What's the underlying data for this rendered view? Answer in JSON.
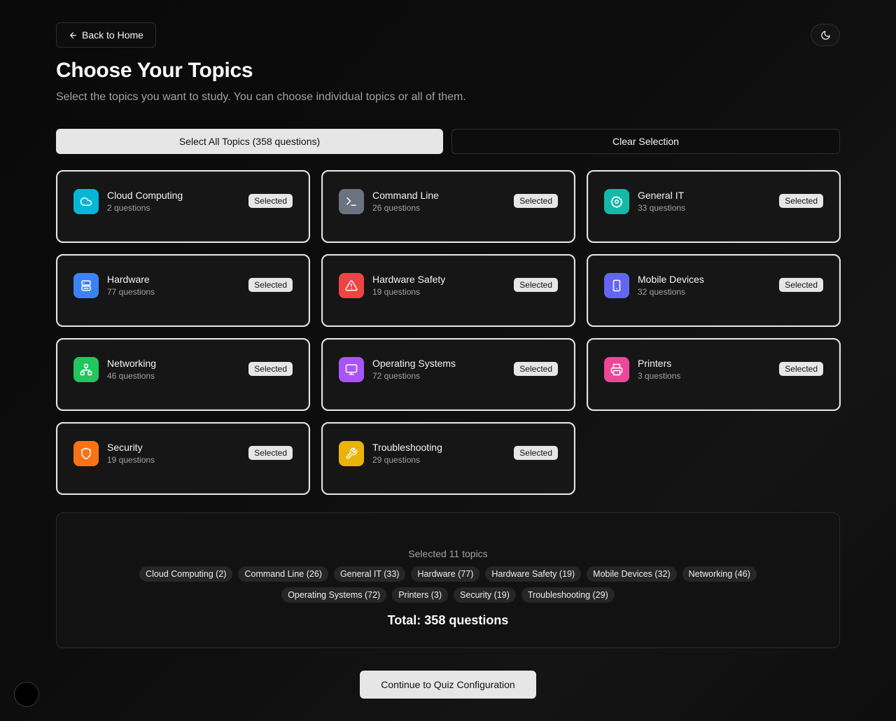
{
  "header": {
    "back_label": "Back to Home",
    "title": "Choose Your Topics",
    "subtitle": "Select the topics you want to study. You can choose individual topics or all of them."
  },
  "actions": {
    "select_all_label": "Select All Topics (358 questions)",
    "clear_label": "Clear Selection"
  },
  "topics": [
    {
      "name": "Cloud Computing",
      "count": "2 questions",
      "badge": "Selected",
      "icon": "cloud-icon",
      "color": "#06b6d4"
    },
    {
      "name": "Command Line",
      "count": "26 questions",
      "badge": "Selected",
      "icon": "terminal-icon",
      "color": "#6b7280"
    },
    {
      "name": "General IT",
      "count": "33 questions",
      "badge": "Selected",
      "icon": "gear-icon",
      "color": "#14b8a6"
    },
    {
      "name": "Hardware",
      "count": "77 questions",
      "badge": "Selected",
      "icon": "server-icon",
      "color": "#3b82f6"
    },
    {
      "name": "Hardware Safety",
      "count": "19 questions",
      "badge": "Selected",
      "icon": "warning-icon",
      "color": "#ef4444"
    },
    {
      "name": "Mobile Devices",
      "count": "32 questions",
      "badge": "Selected",
      "icon": "tablet-icon",
      "color": "#6366f1"
    },
    {
      "name": "Networking",
      "count": "46 questions",
      "badge": "Selected",
      "icon": "network-icon",
      "color": "#22c55e"
    },
    {
      "name": "Operating Systems",
      "count": "72 questions",
      "badge": "Selected",
      "icon": "monitor-icon",
      "color": "#a855f7"
    },
    {
      "name": "Printers",
      "count": "3 questions",
      "badge": "Selected",
      "icon": "printer-icon",
      "color": "#ec4899"
    },
    {
      "name": "Security",
      "count": "19 questions",
      "badge": "Selected",
      "icon": "shield-icon",
      "color": "#f97316"
    },
    {
      "name": "Troubleshooting",
      "count": "29 questions",
      "badge": "Selected",
      "icon": "wrench-icon",
      "color": "#eab308"
    }
  ],
  "summary": {
    "caption": "Selected 11 topics",
    "chips_row1": [
      "Cloud Computing (2)",
      "Command Line (26)",
      "General IT (33)",
      "Hardware (77)",
      "Hardware Safety (19)",
      "Mobile Devices (32)",
      "Networking (46)"
    ],
    "chips_row2": [
      "Operating Systems (72)",
      "Printers (3)",
      "Security (19)",
      "Troubleshooting (29)"
    ],
    "total": "Total: 358 questions"
  },
  "continue_label": "Continue to Quiz Configuration"
}
